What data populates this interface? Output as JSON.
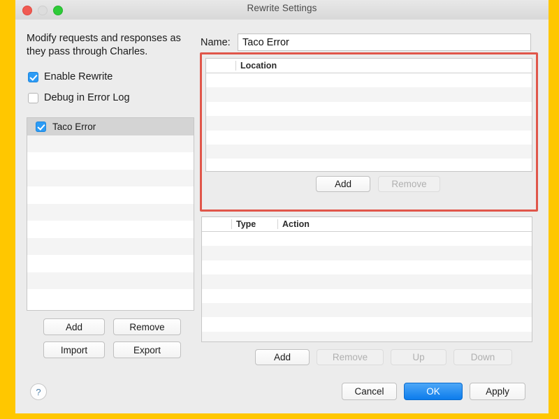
{
  "window": {
    "title": "Rewrite Settings",
    "traffic_lights": [
      "close-button",
      "minimize-button",
      "zoom-button"
    ]
  },
  "left_panel": {
    "description": "Modify requests and responses as they pass through Charles.",
    "checkboxes": [
      {
        "label": "Enable Rewrite",
        "checked": true
      },
      {
        "label": "Debug in Error Log",
        "checked": false
      }
    ],
    "rule_list": {
      "items": [
        {
          "label": "Taco Error",
          "checked": true,
          "selected": true
        }
      ],
      "empty_rows": 10
    },
    "buttons": {
      "add": "Add",
      "remove": "Remove",
      "import": "Import",
      "export": "Export"
    }
  },
  "right_panel": {
    "name_label": "Name:",
    "name_value": "Taco Error",
    "name_placeholder": "",
    "location_table": {
      "columns": [
        "Location"
      ],
      "rows": [],
      "empty_rows": 7,
      "buttons": {
        "add": "Add",
        "remove": "Remove",
        "remove_disabled": true
      }
    },
    "action_table": {
      "columns": [
        "Type",
        "Action"
      ],
      "rows": [],
      "empty_rows": 8,
      "buttons": {
        "add": "Add",
        "remove": "Remove",
        "up": "Up",
        "down": "Down",
        "remove_disabled": true,
        "up_disabled": true,
        "down_disabled": true
      }
    }
  },
  "footer": {
    "help": "?",
    "cancel": "Cancel",
    "ok": "OK",
    "apply": "Apply"
  },
  "annotation": {
    "highlight_color": "#E0564A",
    "target": "location-section"
  },
  "colors": {
    "page_background": "#FFC700",
    "window_background": "#ECECEC",
    "accent_blue": "#0C7CEC",
    "checkbox_blue": "#2C9BF5",
    "selected_row": "#D4D4D4",
    "stripe_row": "#F4F4F4"
  }
}
